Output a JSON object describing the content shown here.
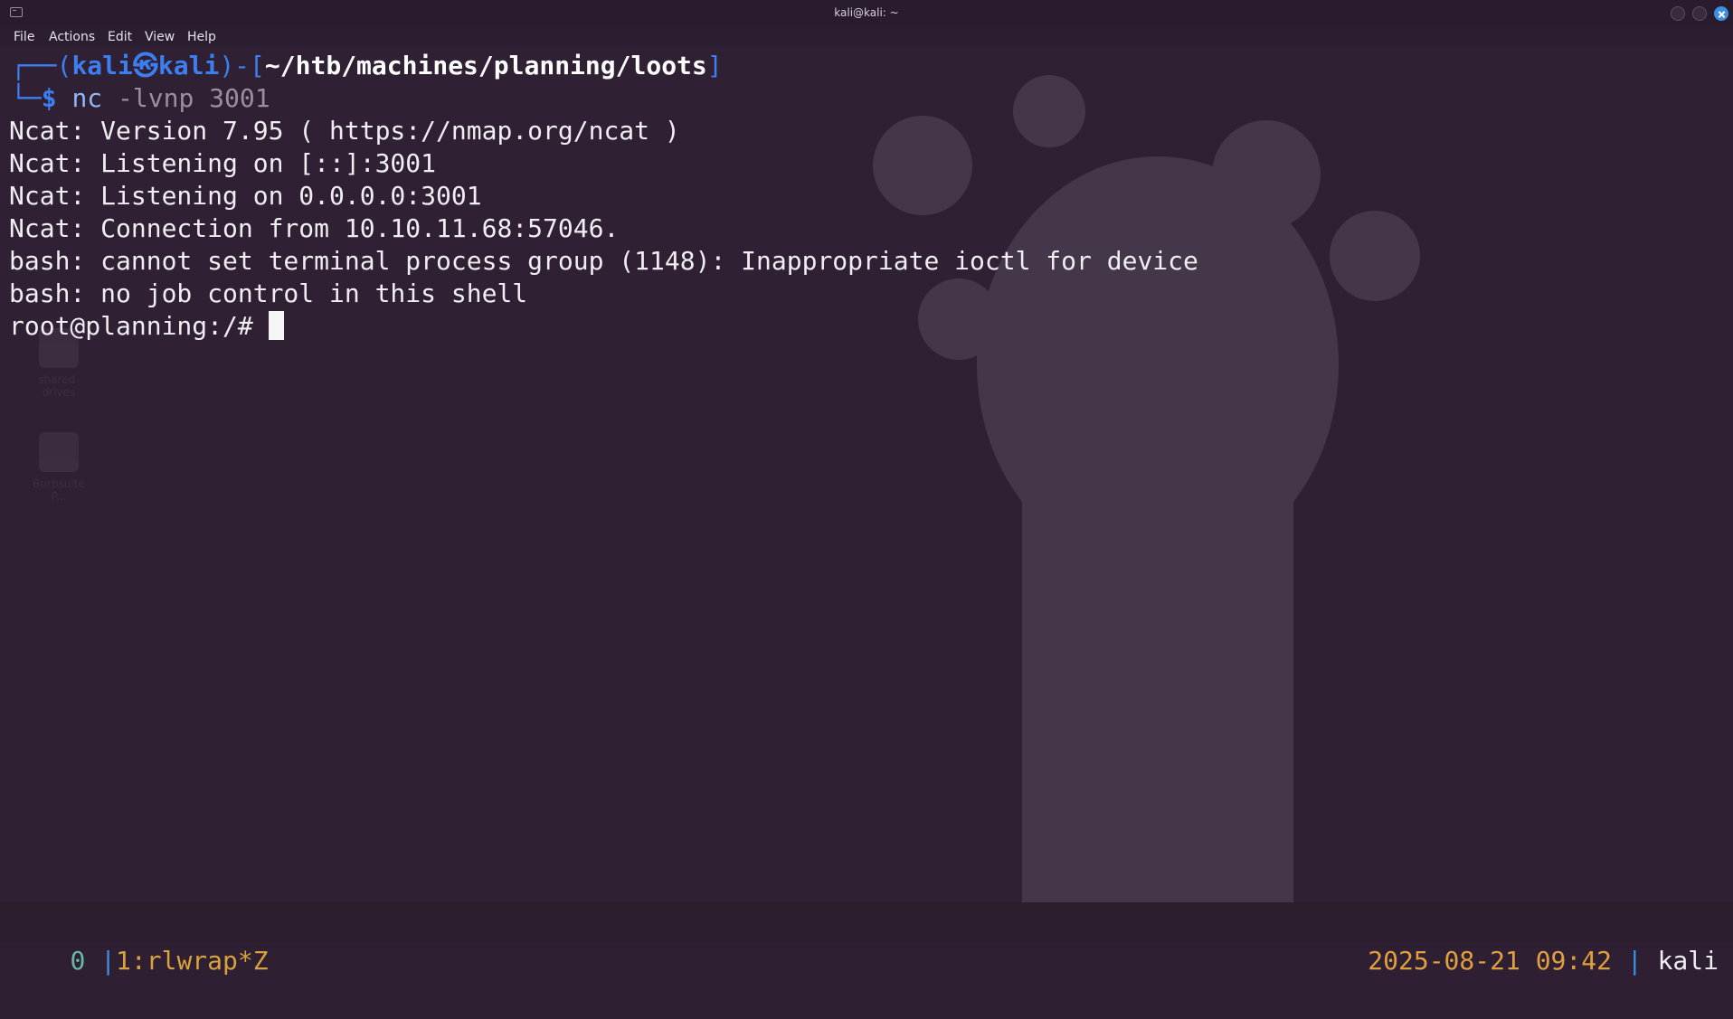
{
  "window": {
    "title": "kali@kali: ~"
  },
  "menu": {
    "items": [
      "File",
      "Actions",
      "Edit",
      "View",
      "Help"
    ]
  },
  "desktop_ghosts": [
    "shared-drives",
    "Burpsuite P..."
  ],
  "terminal": {
    "prompt_user": "kali",
    "prompt_host": "kali",
    "prompt_path": "~/htb/machines/planning/loots",
    "command": "nc",
    "command_args": " -lvnp 3001",
    "output": [
      "Ncat: Version 7.95 ( https://nmap.org/ncat )",
      "Ncat: Listening on [::]:3001",
      "Ncat: Listening on 0.0.0.0:3001",
      "Ncat: Connection from 10.10.11.68:57046.",
      "bash: cannot set terminal process group (1148): Inappropriate ioctl for device",
      "bash: no job control in this shell"
    ],
    "shell_prompt": "root@planning:/# "
  },
  "statusbar": {
    "session_index": "0",
    "window": "1:rlwrap*Z",
    "datetime": "2025-08-21 09:42",
    "user": "kali"
  },
  "colors": {
    "accent": "#3d7ff0",
    "status_text": "#d9a23c",
    "background": "#2f2034"
  }
}
